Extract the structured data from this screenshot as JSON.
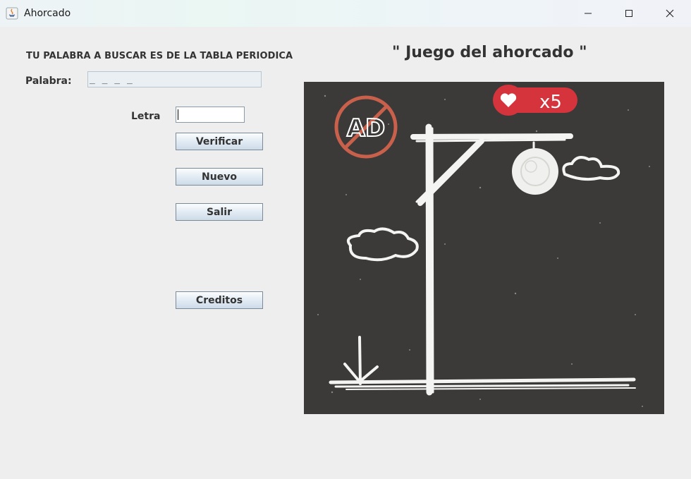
{
  "window": {
    "title": "Ahorcado"
  },
  "left": {
    "hint": "TU PALABRA A BUSCAR ES DE LA TABLA PERIODICA",
    "palabra_label": "Palabra:",
    "palabra_value": "_ _ _ _",
    "letra_label": "Letra",
    "letra_value": "",
    "buttons": {
      "verificar": "Verificar",
      "nuevo": "Nuevo",
      "salir": "Salir",
      "creditos": "Creditos"
    }
  },
  "game": {
    "title": "\" Juego del ahorcado \"",
    "ad_badge": "AD",
    "lives": "x5"
  },
  "colors": {
    "background": "#eeeeee",
    "chalkboard": "#3b3a38",
    "heart_badge": "#d6343d"
  }
}
